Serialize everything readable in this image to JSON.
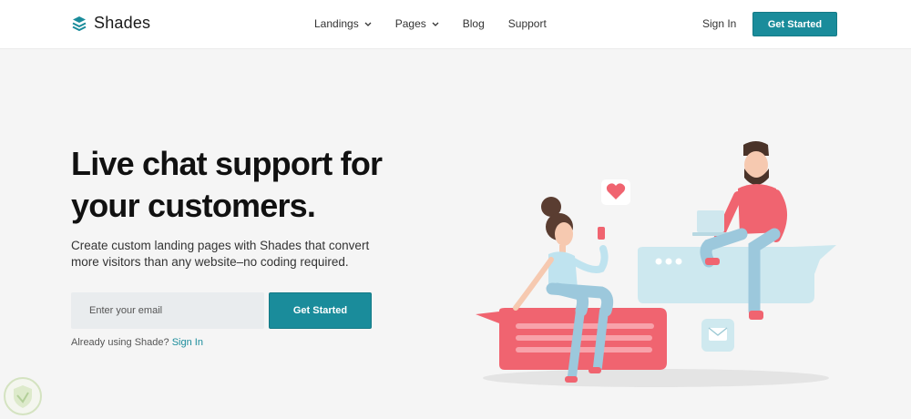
{
  "header": {
    "brand": "Shades",
    "nav": [
      {
        "label": "Landings",
        "has_dropdown": true
      },
      {
        "label": "Pages",
        "has_dropdown": true
      },
      {
        "label": "Blog",
        "has_dropdown": false
      },
      {
        "label": "Support",
        "has_dropdown": false
      }
    ],
    "signin_label": "Sign In",
    "cta_label": "Get Started"
  },
  "hero": {
    "title": "Live chat support for your customers.",
    "subtitle": "Create custom landing pages with Shades that convert more visitors than any website–no coding required.",
    "email_placeholder": "Enter your email",
    "cta_label": "Get Started",
    "already_text": "Already using Shade?",
    "already_link": "Sign In"
  },
  "colors": {
    "accent": "#1a8c9b",
    "background": "#f5f5f5",
    "header_bg": "#ffffff"
  },
  "icons": {
    "logo": "stacked-layers-icon",
    "dropdown": "chevron-down-icon",
    "heart": "heart-icon",
    "mail": "mail-icon"
  }
}
